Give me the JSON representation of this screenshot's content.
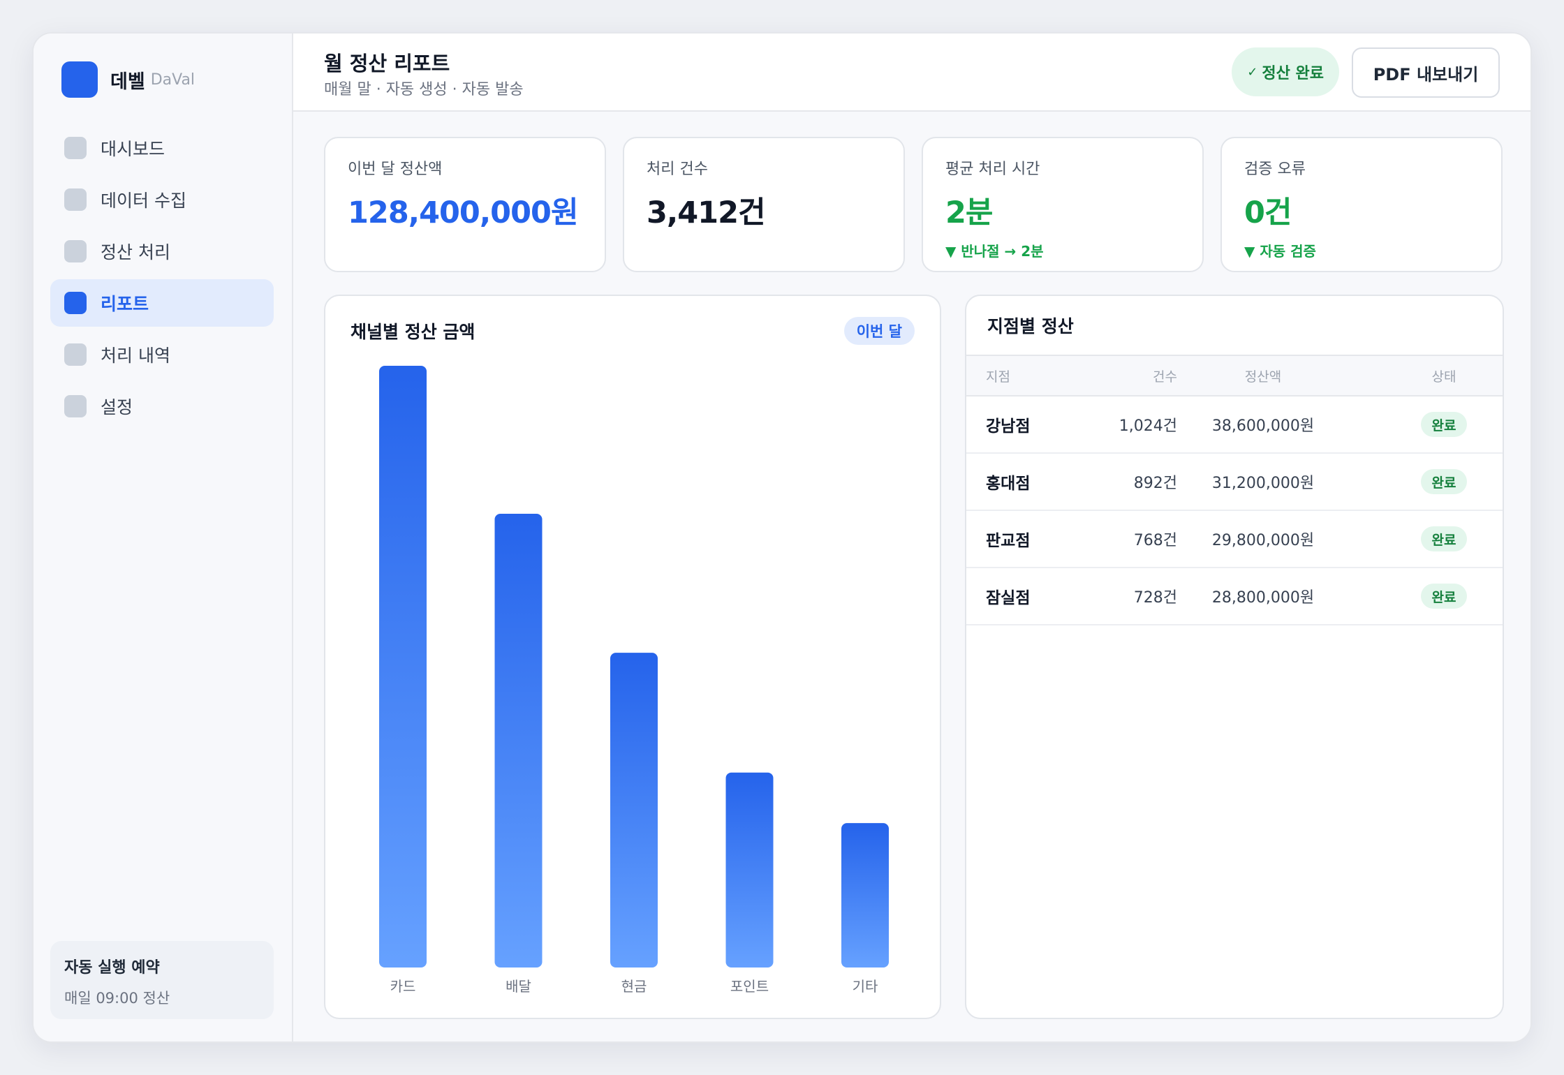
{
  "brand": {
    "name": "데벨",
    "sub": "DaVal"
  },
  "sidebar": {
    "items": [
      {
        "label": "대시보드",
        "active": false
      },
      {
        "label": "데이터 수집",
        "active": false
      },
      {
        "label": "정산 처리",
        "active": false
      },
      {
        "label": "리포트",
        "active": true
      },
      {
        "label": "처리 내역",
        "active": false
      },
      {
        "label": "설정",
        "active": false
      }
    ],
    "schedule": {
      "title": "자동 실행 예약",
      "detail": "매일 09:00 정산"
    }
  },
  "header": {
    "title": "월 정산 리포트",
    "subtitle": "매월 말 · 자동 생성 · 자동 발송",
    "status_check": "✓",
    "status_label": "정산 완료",
    "export_label": "PDF 내보내기"
  },
  "kpis": [
    {
      "label": "이번 달 정산액",
      "value": "128,400,000원",
      "trend": ""
    },
    {
      "label": "처리 건수",
      "value": "3,412건",
      "trend": ""
    },
    {
      "label": "평균 처리 시간",
      "value": "2분",
      "trend": "▼ 반나절 → 2분"
    },
    {
      "label": "검증 오류",
      "value": "0건",
      "trend": "▼ 자동 검증"
    }
  ],
  "chart": {
    "title": "채널별 정산 금액",
    "badge": "이번 달"
  },
  "chart_data": {
    "type": "bar",
    "title": "채널별 정산 금액",
    "categories": [
      "카드",
      "배달",
      "현금",
      "포인트",
      "기타"
    ],
    "values": [
      100,
      75.4,
      52.3,
      32.4,
      24
    ],
    "ylim": [
      0,
      100
    ],
    "grid": false,
    "colors": {
      "bar_top": "#2563eb",
      "bar_bottom": "#66a1ff"
    }
  },
  "table": {
    "title": "지점별 정산",
    "columns": [
      "지점",
      "건수",
      "정산액",
      "상태"
    ],
    "rows": [
      {
        "branch": "강남점",
        "count": "1,024건",
        "amount": "38,600,000원",
        "status": "완료"
      },
      {
        "branch": "홍대점",
        "count": "892건",
        "amount": "31,200,000원",
        "status": "완료"
      },
      {
        "branch": "판교점",
        "count": "768건",
        "amount": "29,800,000원",
        "status": "완료"
      },
      {
        "branch": "잠실점",
        "count": "728건",
        "amount": "28,800,000원",
        "status": "완료"
      }
    ]
  }
}
